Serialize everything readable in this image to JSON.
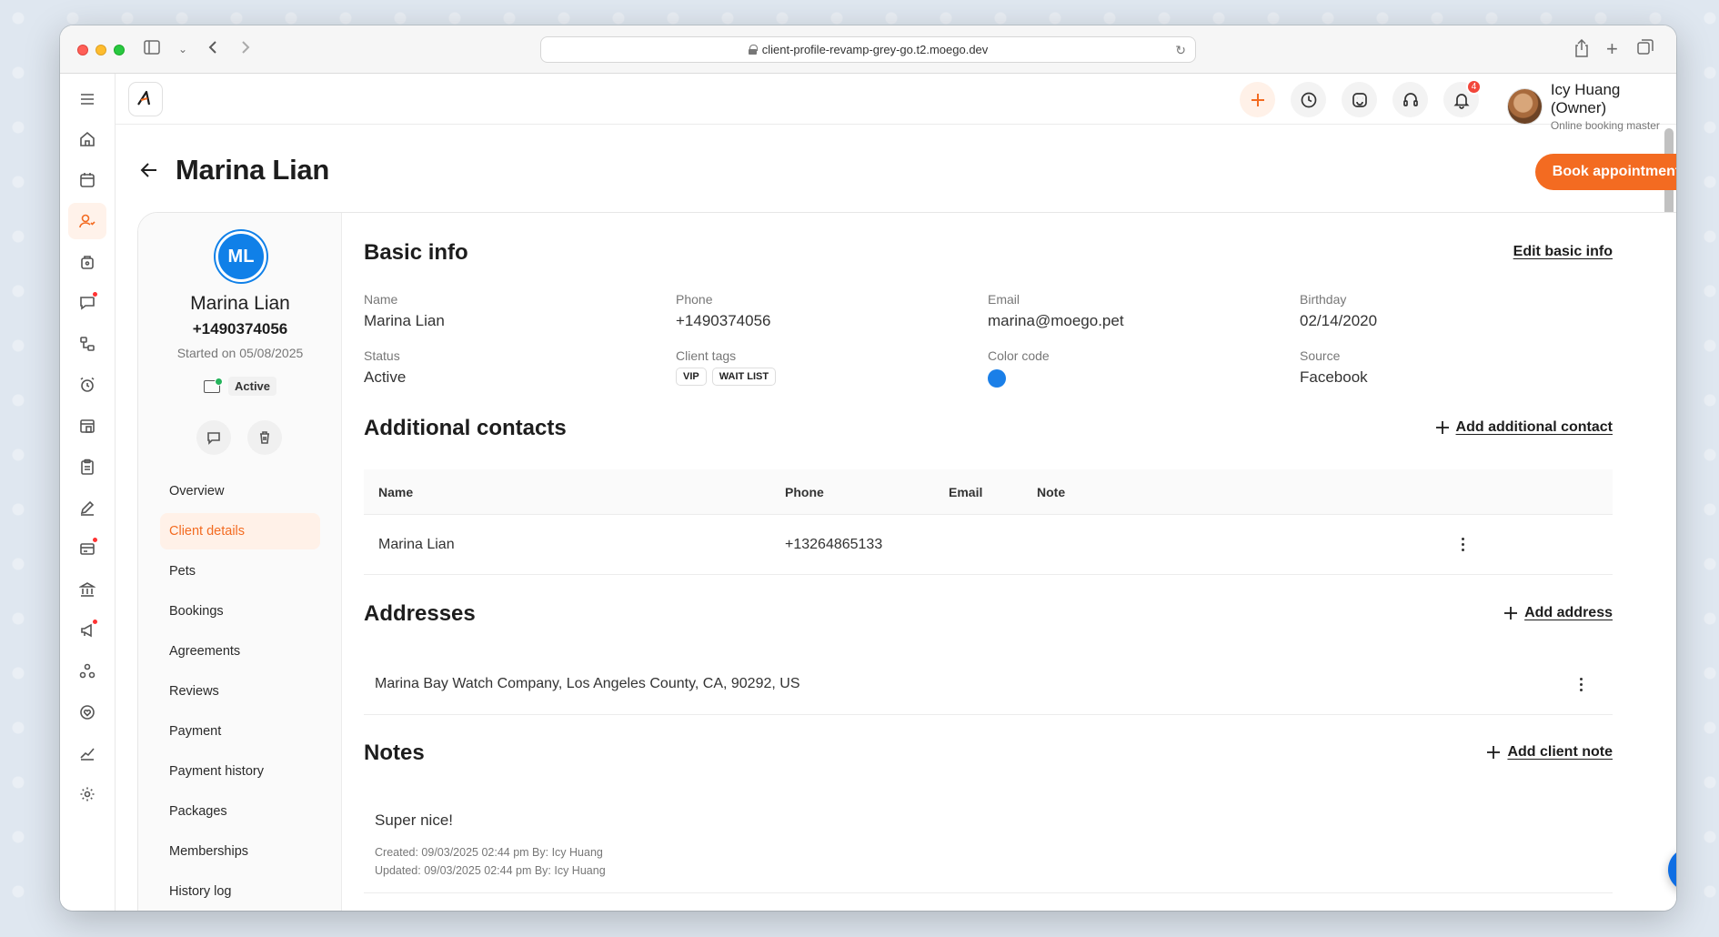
{
  "browser": {
    "url": "client-profile-revamp-grey-go.t2.moego.dev"
  },
  "topnav": {
    "notification_count": "4",
    "user_name": "Icy Huang (Owner)",
    "user_subtitle": "Online booking master"
  },
  "page": {
    "title": "Marina Lian",
    "book_button": "Book appointment"
  },
  "profile": {
    "initials": "ML",
    "name": "Marina Lian",
    "phone": "+1490374056",
    "started": "Started on 05/08/2025",
    "status": "Active",
    "menu": [
      {
        "label": "Overview"
      },
      {
        "label": "Client details"
      },
      {
        "label": "Pets"
      },
      {
        "label": "Bookings"
      },
      {
        "label": "Agreements"
      },
      {
        "label": "Reviews"
      },
      {
        "label": "Payment"
      },
      {
        "label": "Payment history"
      },
      {
        "label": "Packages"
      },
      {
        "label": "Memberships"
      },
      {
        "label": "History log"
      }
    ]
  },
  "basic_info": {
    "title": "Basic info",
    "edit_label": "Edit basic info",
    "name_label": "Name",
    "name_value": "Marina Lian",
    "phone_label": "Phone",
    "phone_value": "+1490374056",
    "email_label": "Email",
    "email_value": "marina@moego.pet",
    "birthday_label": "Birthday",
    "birthday_value": "02/14/2020",
    "status_label": "Status",
    "status_value": "Active",
    "tags_label": "Client tags",
    "tags": [
      "VIP",
      "WAIT LIST"
    ],
    "color_label": "Color code",
    "color_value": "#1a7fe8",
    "source_label": "Source",
    "source_value": "Facebook"
  },
  "additional_contacts": {
    "title": "Additional contacts",
    "add_label": "Add additional contact",
    "columns": [
      "Name",
      "Phone",
      "Email",
      "Note"
    ],
    "rows": [
      {
        "name": "Marina Lian",
        "phone": "+13264865133",
        "email": "",
        "note": ""
      }
    ]
  },
  "addresses": {
    "title": "Addresses",
    "add_label": "Add address",
    "items": [
      "Marina Bay Watch Company, Los Angeles County, CA, 90292, US"
    ]
  },
  "notes": {
    "title": "Notes",
    "add_label": "Add client note",
    "items": [
      {
        "text": "Super nice!",
        "created": "Created: 09/03/2025 02:44 pm By: Icy Huang",
        "updated": "Updated: 09/03/2025 02:44 pm By: Icy Huang"
      }
    ]
  },
  "colors": {
    "brand": "#f36b21",
    "avatar": "#1080e8",
    "chat": "#0f6ee3"
  }
}
